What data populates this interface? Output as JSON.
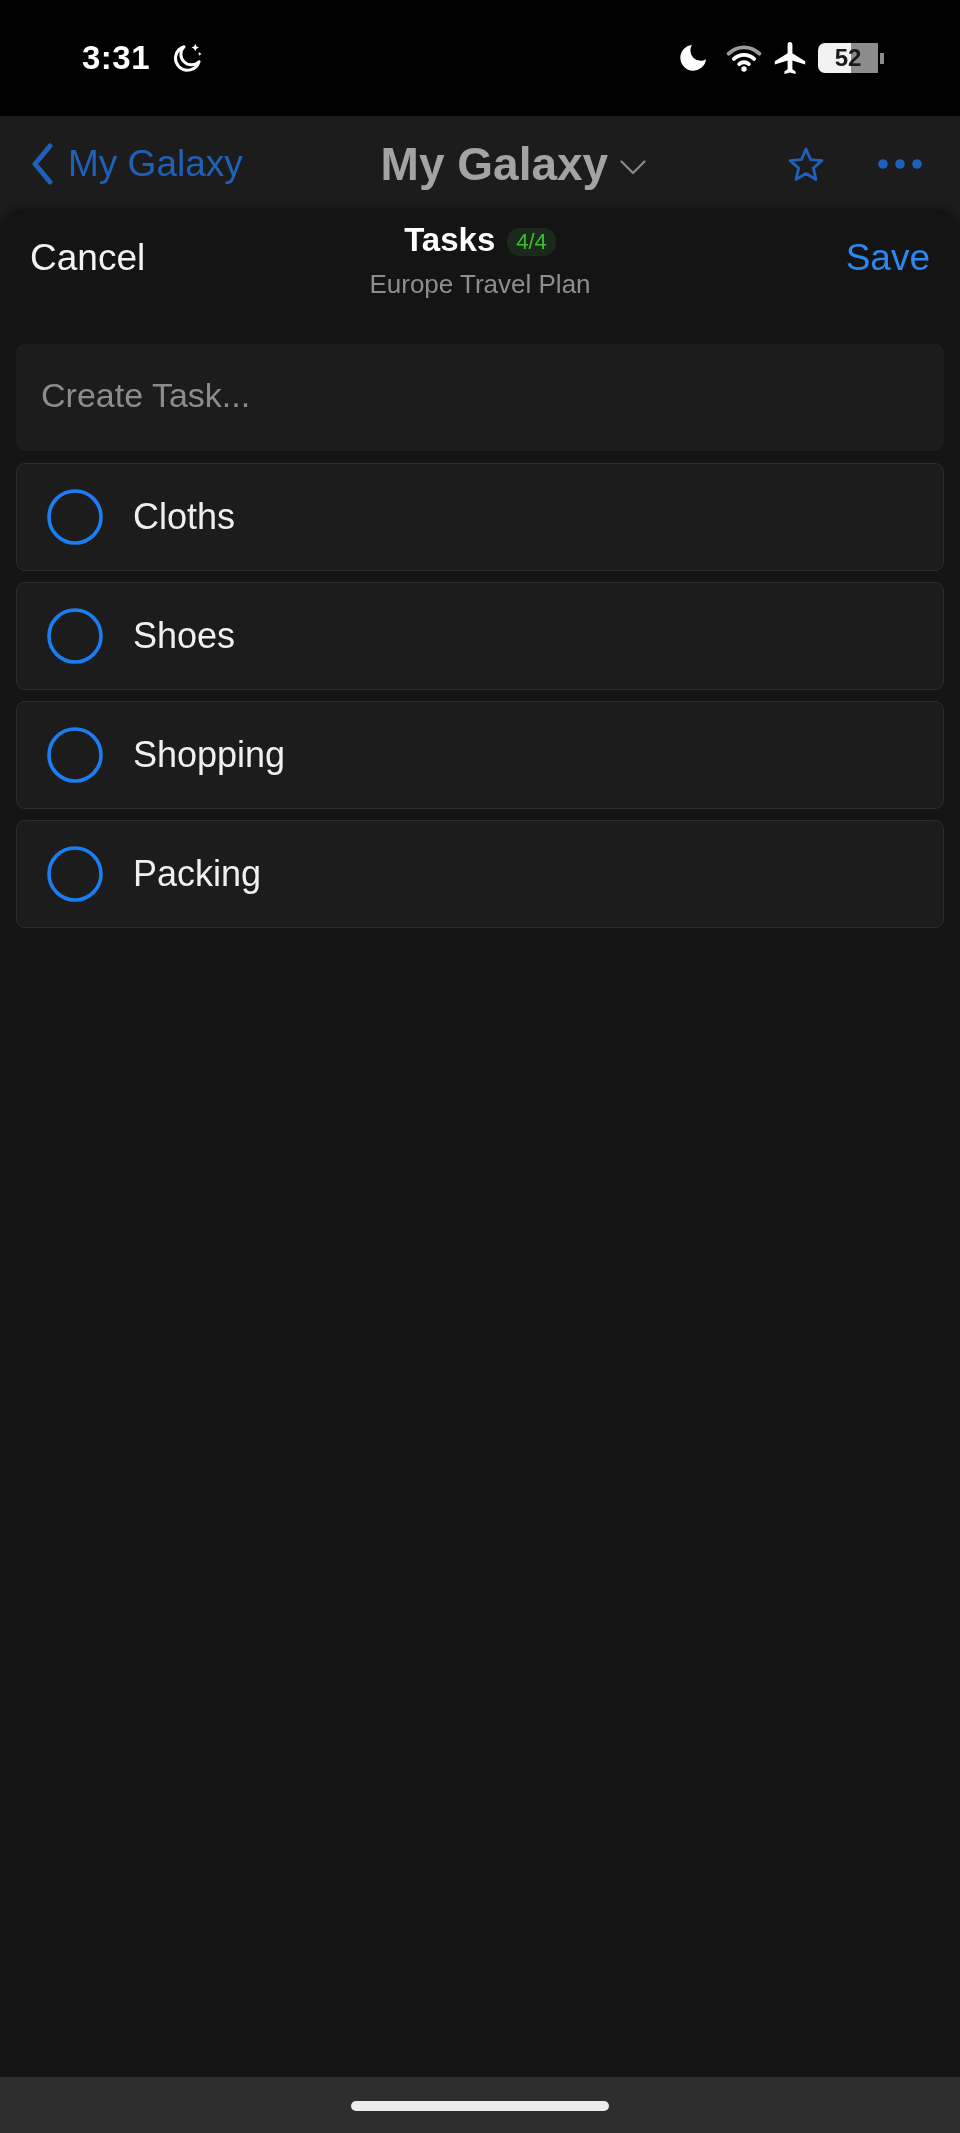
{
  "status_bar": {
    "time": "3:31",
    "battery": "52"
  },
  "nav_bar": {
    "back_label": "My Galaxy",
    "title": "My Galaxy"
  },
  "sheet": {
    "cancel": "Cancel",
    "title": "Tasks",
    "count_badge": "4/4",
    "subtitle": "Europe Travel Plan",
    "save": "Save"
  },
  "create_task": {
    "placeholder": "Create Task..."
  },
  "tasks": [
    {
      "label": "Cloths",
      "checked": false
    },
    {
      "label": "Shoes",
      "checked": false
    },
    {
      "label": "Shopping",
      "checked": false
    },
    {
      "label": "Packing",
      "checked": false
    }
  ]
}
